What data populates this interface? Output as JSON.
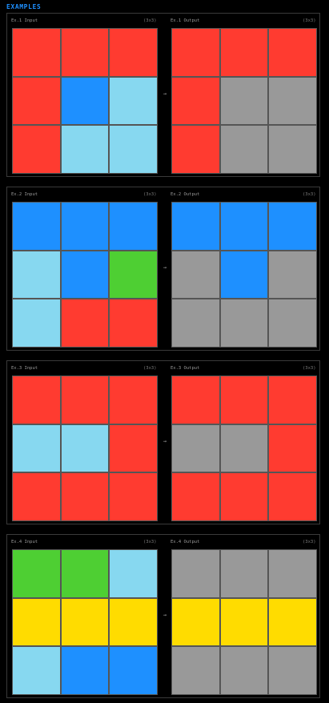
{
  "header": "EXAMPLES",
  "palette": {
    "R": "#ff3b30",
    "B": "#1e90ff",
    "L": "#87d8f0",
    "G": "#999999",
    "N": "#4ecf33",
    "Y": "#ffdc00"
  },
  "examples": [
    {
      "input_label": "Ex.1 Input",
      "input_size": "(3x3)",
      "output_label": "Ex.1 Output",
      "output_size": "(3x3)",
      "arrow": "→",
      "input": [
        [
          "R",
          "R",
          "R"
        ],
        [
          "R",
          "B",
          "L"
        ],
        [
          "R",
          "L",
          "L"
        ]
      ],
      "output": [
        [
          "R",
          "R",
          "R"
        ],
        [
          "R",
          "G",
          "G"
        ],
        [
          "R",
          "G",
          "G"
        ]
      ]
    },
    {
      "input_label": "Ex.2 Input",
      "input_size": "(3x3)",
      "output_label": "Ex.2 Output",
      "output_size": "(3x3)",
      "arrow": "→",
      "input": [
        [
          "B",
          "B",
          "B"
        ],
        [
          "L",
          "B",
          "N"
        ],
        [
          "L",
          "R",
          "R"
        ]
      ],
      "output": [
        [
          "B",
          "B",
          "B"
        ],
        [
          "G",
          "B",
          "G"
        ],
        [
          "G",
          "G",
          "G"
        ]
      ]
    },
    {
      "input_label": "Ex.3 Input",
      "input_size": "(3x3)",
      "output_label": "Ex.3 Output",
      "output_size": "(3x3)",
      "arrow": "→",
      "input": [
        [
          "R",
          "R",
          "R"
        ],
        [
          "L",
          "L",
          "R"
        ],
        [
          "R",
          "R",
          "R"
        ]
      ],
      "output": [
        [
          "R",
          "R",
          "R"
        ],
        [
          "G",
          "G",
          "R"
        ],
        [
          "R",
          "R",
          "R"
        ]
      ]
    },
    {
      "input_label": "Ex.4 Input",
      "input_size": "(3x3)",
      "output_label": "Ex.4 Output",
      "output_size": "(3x3)",
      "arrow": "→",
      "input": [
        [
          "N",
          "N",
          "L"
        ],
        [
          "Y",
          "Y",
          "Y"
        ],
        [
          "L",
          "B",
          "B"
        ]
      ],
      "output": [
        [
          "G",
          "G",
          "G"
        ],
        [
          "Y",
          "Y",
          "Y"
        ],
        [
          "G",
          "G",
          "G"
        ]
      ]
    }
  ]
}
